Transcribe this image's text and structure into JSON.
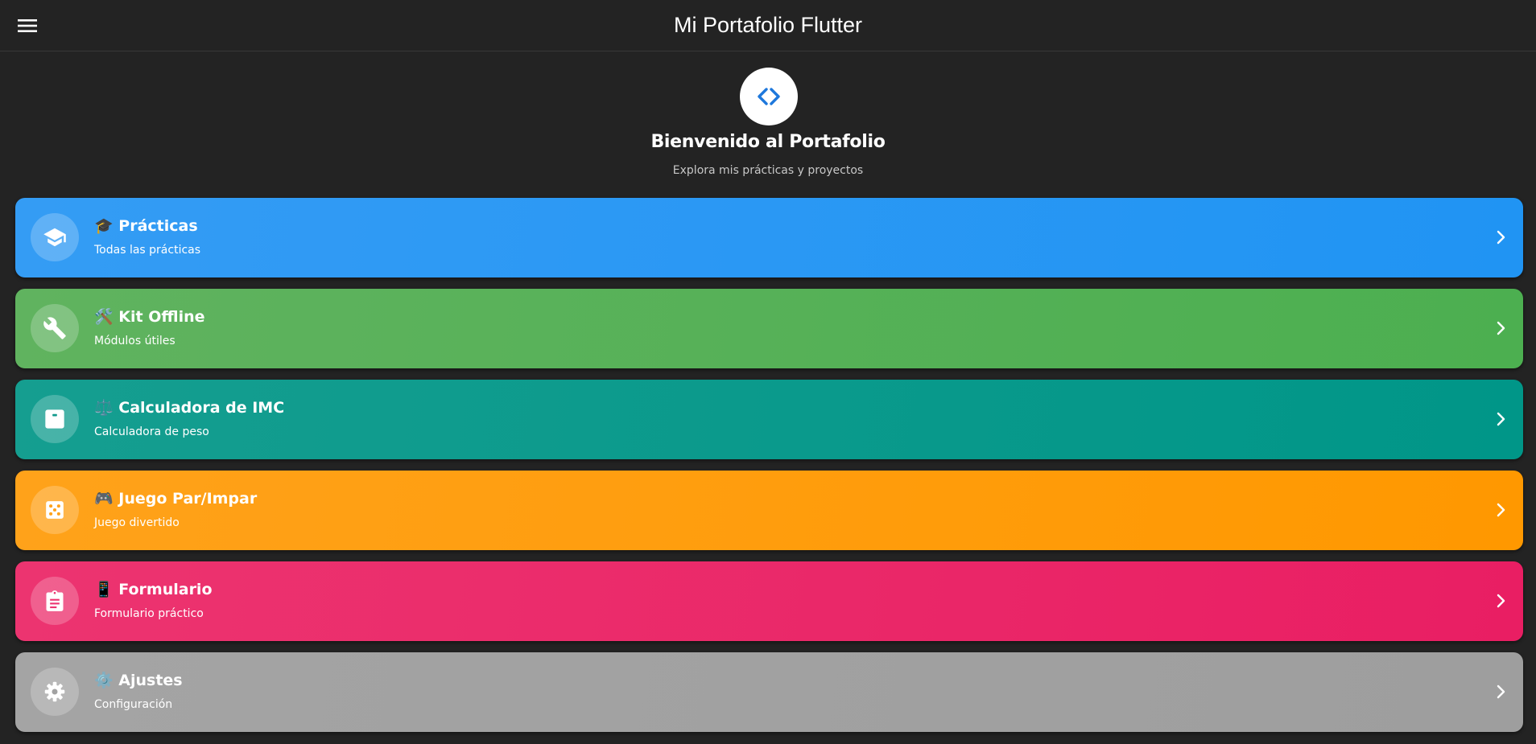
{
  "app_bar": {
    "title": "Mi Portafolio Flutter",
    "menu_icon": "menu-icon"
  },
  "hero": {
    "icon": "code-icon",
    "title": "Bienvenido al Portafolio",
    "subtitle": "Explora mis prácticas y proyectos",
    "icon_color": "#1976d2"
  },
  "cards": [
    {
      "icon": "school-icon",
      "title": "🎓 Prácticas",
      "subtitle": "Todas las prácticas",
      "color": "#2196f3"
    },
    {
      "icon": "wrench-icon",
      "title": "🛠️ Kit Offline",
      "subtitle": "Módulos útiles",
      "color": "#4caf50"
    },
    {
      "icon": "scale-icon",
      "title": "⚖️ Calculadora de IMC",
      "subtitle": "Calculadora de peso",
      "color": "#009688"
    },
    {
      "icon": "dice-icon",
      "title": "🎮 Juego Par/Impar",
      "subtitle": "Juego divertido",
      "color": "#ff9800"
    },
    {
      "icon": "clipboard-icon",
      "title": "📱 Formulario",
      "subtitle": "Formulario práctico",
      "color": "#e91e63"
    },
    {
      "icon": "gear-icon",
      "title": "⚙️ Ajustes",
      "subtitle": "Configuración",
      "color": "#9e9e9e"
    }
  ]
}
